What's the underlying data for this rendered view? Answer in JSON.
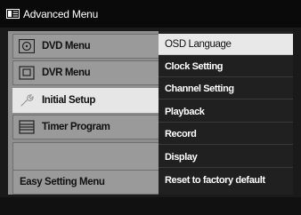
{
  "window": {
    "title": "Advanced Menu",
    "title_icon": "menu-list-icon"
  },
  "left_menu": [
    {
      "label": "DVD Menu",
      "icon": "disc-icon"
    },
    {
      "label": "DVR Menu",
      "icon": "hdd-icon"
    },
    {
      "label": "Initial Setup",
      "icon": "wrench-icon",
      "active": true
    },
    {
      "label": "Timer Program",
      "icon": "timer-list-icon"
    },
    {
      "label": "",
      "icon": ""
    },
    {
      "label": "Easy Setting Menu",
      "icon": ""
    }
  ],
  "right_menu": [
    {
      "label": "OSD Language",
      "selected": true
    },
    {
      "label": "Clock Setting"
    },
    {
      "label": "Channel Setting"
    },
    {
      "label": "Playback"
    },
    {
      "label": "Record"
    },
    {
      "label": "Display"
    },
    {
      "label": "Reset to factory default"
    }
  ],
  "colors": {
    "accent_selected": "#e8e8e8",
    "left_bg": "#8f8f8f",
    "right_bg": "#202020"
  }
}
